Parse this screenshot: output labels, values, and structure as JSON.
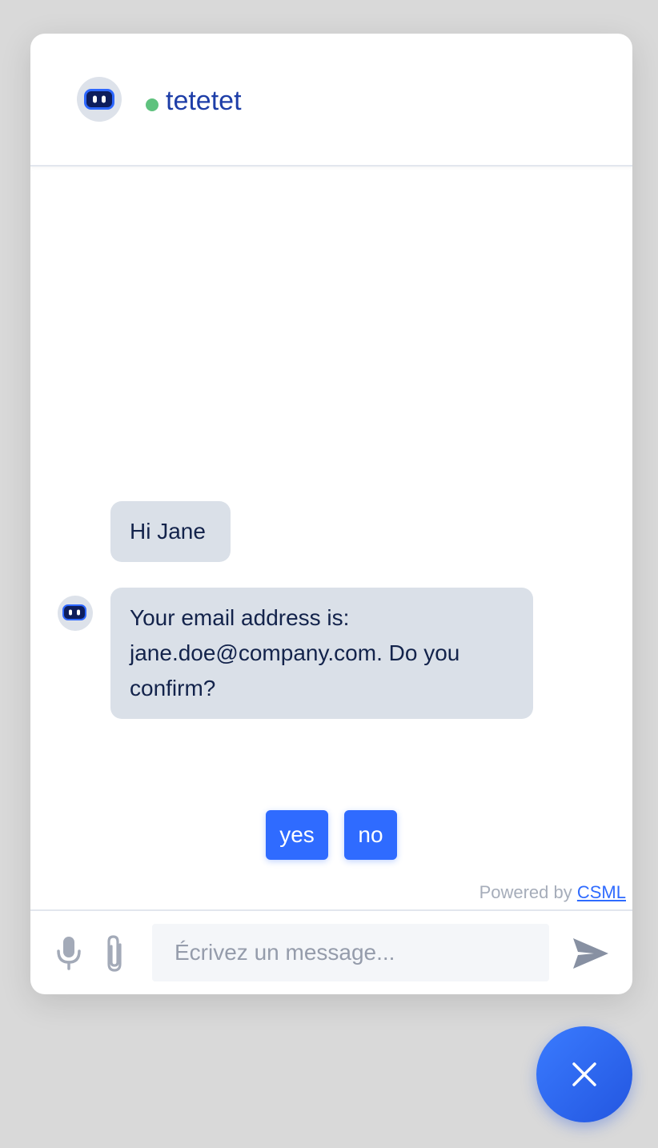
{
  "header": {
    "bot_name": "tetetet",
    "status_color": "#5fc27e",
    "avatar_icon": "robot-icon"
  },
  "messages": [
    {
      "text": "Hi Jane"
    },
    {
      "text": "Your email address is: jane.doe@company.com. Do you confirm?"
    }
  ],
  "quick_replies": [
    "yes",
    "no"
  ],
  "powered_by": {
    "prefix": "Powered by ",
    "link": "CSML"
  },
  "composer": {
    "placeholder": "Écrivez un message...",
    "mic_icon": "microphone-icon",
    "attach_icon": "paperclip-icon",
    "send_icon": "send-icon"
  },
  "launcher": {
    "icon": "close-icon",
    "color": "#2f6bff"
  }
}
